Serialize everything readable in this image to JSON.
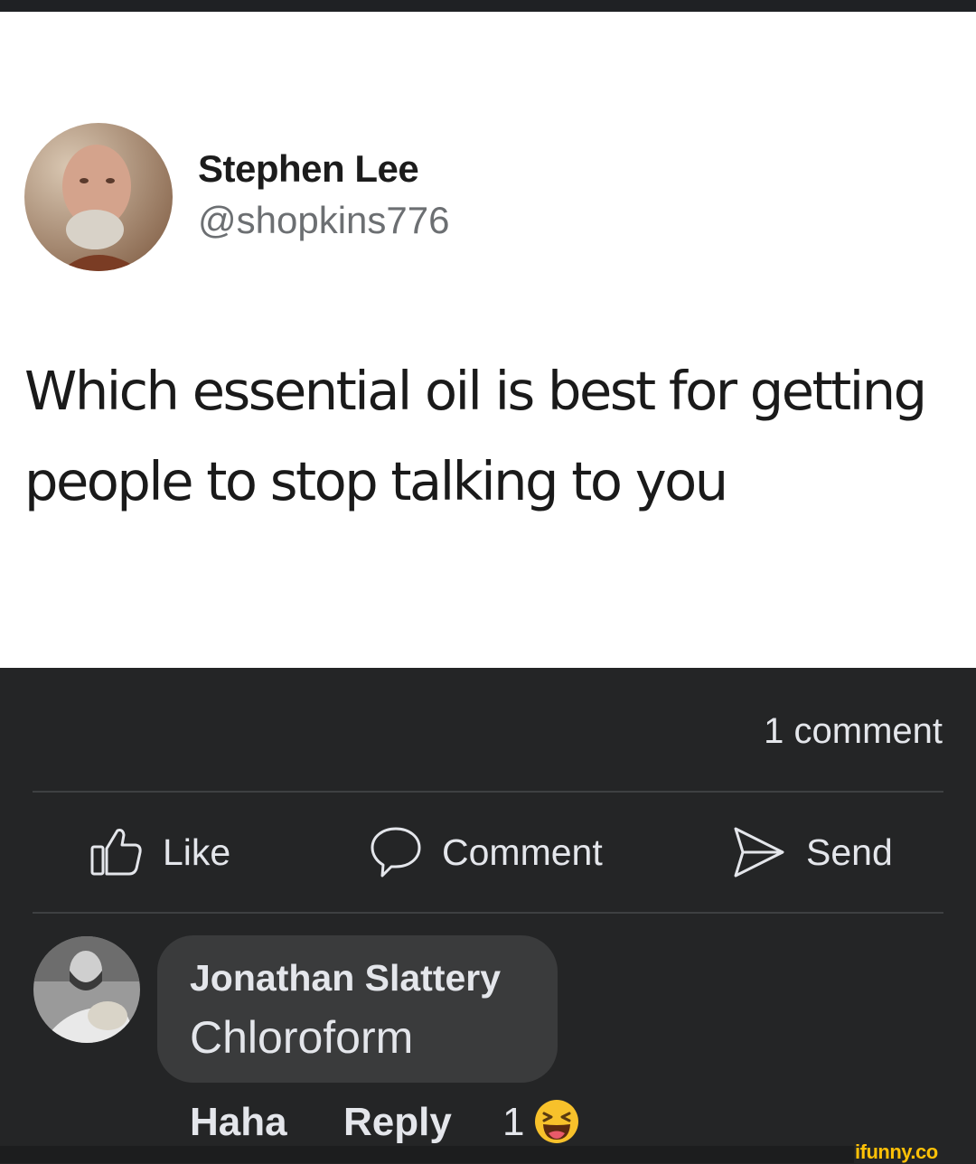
{
  "tweet": {
    "author_name": "Stephen Lee",
    "author_handle": "@shopkins776",
    "text_line1": "Which essential oil is best for getting",
    "text_line2": "people to stop talking to you"
  },
  "post": {
    "comment_count": "1 comment",
    "actions": {
      "like": "Like",
      "comment": "Comment",
      "send": "Send"
    }
  },
  "comment": {
    "author": "Jonathan Slattery",
    "text": "Chloroform",
    "actions": {
      "haha": "Haha",
      "reply": "Reply"
    },
    "reaction_count": "1",
    "reaction_icon": "laughing-emoji-icon"
  },
  "watermark": "ifunny.co",
  "colors": {
    "tweet_background": "#ffffff",
    "fb_background": "#242526",
    "bubble": "#3a3b3c",
    "text_primary": "#e4e6eb",
    "watermark": "#ffc107"
  }
}
